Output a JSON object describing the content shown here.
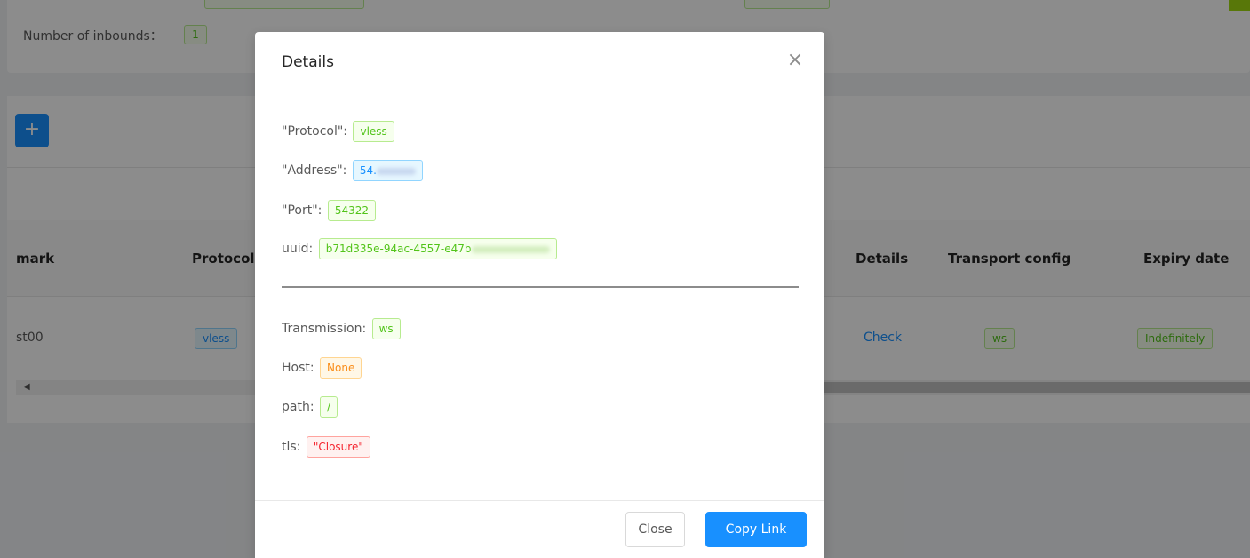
{
  "background": {
    "number_of_inbounds_label": "Number of inbounds：",
    "number_of_inbounds_value": "1",
    "add_button": "+",
    "table": {
      "headers": [
        "mark",
        "Protocol",
        "Details",
        "Transport config",
        "Expiry date"
      ],
      "row": {
        "remark": "st00",
        "protocol": "vless",
        "details_link": "Check",
        "transport": "ws",
        "expiry": "Indefinitely"
      }
    }
  },
  "modal": {
    "title": "Details",
    "close_icon": "×",
    "fields": {
      "protocol_label": "\"Protocol\":",
      "protocol_value": "vless",
      "address_label": "\"Address\":",
      "address_value": "54.",
      "port_label": "\"Port\":",
      "port_value": "54322",
      "uuid_label": "uuid:",
      "uuid_value": "b71d335e-94ac-4557-e47b",
      "transmission_label": "Transmission:",
      "transmission_value": "ws",
      "host_label": "Host:",
      "host_value": "None",
      "path_label": "path:",
      "path_value": "/",
      "tls_label": "tls:",
      "tls_value": "\"Closure\""
    },
    "buttons": {
      "close": "Close",
      "copy_link": "Copy Link"
    }
  },
  "colors": {
    "primary": "#1890ff",
    "green": "#52c41a",
    "orange": "#fa8c16",
    "red": "#f5222d"
  }
}
